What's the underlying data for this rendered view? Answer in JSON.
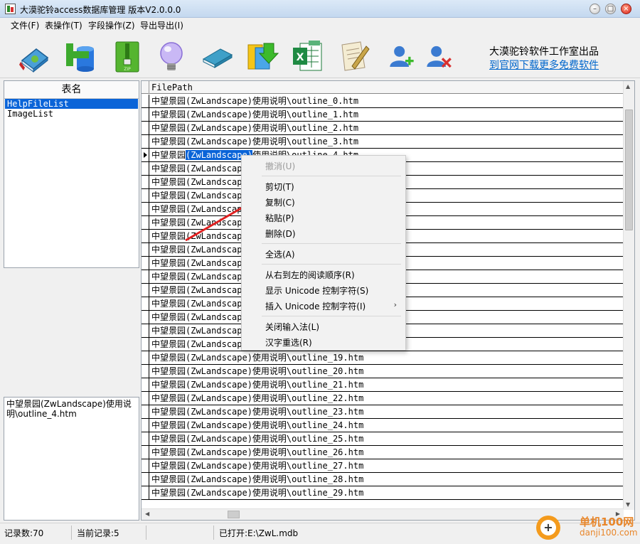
{
  "window": {
    "title": "大漠驼铃access数据库管理 版本V2.0.0.0",
    "minimize_label": "–",
    "maximize_label": "□",
    "close_label": "×"
  },
  "menu": [
    "文件(F)",
    "表操作(T)",
    "字段操作(Z)",
    "导出导出(I)"
  ],
  "toolbar": {
    "icons": [
      "open-database-icon",
      "add-table-icon",
      "zip-icon",
      "lightbulb-icon",
      "book-icon",
      "import-icon",
      "excel-export-icon",
      "edit-document-icon",
      "add-user-icon",
      "remove-user-icon"
    ],
    "studio_name": "大漠驼铃软件工作室出品",
    "download_link": "到官网下载更多免费软件"
  },
  "table_list": {
    "header": "表名",
    "items": [
      "HelpFileList",
      "ImageList"
    ],
    "selected_index": 0
  },
  "detail_text": "中望景园(ZwLandscape)使用说明\\outline_4.htm",
  "grid": {
    "column": "FilePath",
    "current_row": 4,
    "selected_fragment": "(ZwLandscape)",
    "rows": [
      "中望景园(ZwLandscape)使用说明\\outline_0.htm",
      "中望景园(ZwLandscape)使用说明\\outline_1.htm",
      "中望景园(ZwLandscape)使用说明\\outline_2.htm",
      "中望景园(ZwLandscape)使用说明\\outline_3.htm",
      "中望景园(ZwLandscape)使用说明\\outline_4.htm",
      "中望景园(ZwLandscape)使用说明\\outline_5.htm",
      "中望景园(ZwLandscape)使用说明\\outline_6.htm",
      "中望景园(ZwLandscape)使用说明\\outline_7.htm",
      "中望景园(ZwLandscape)使用说明\\outline_8.htm",
      "中望景园(ZwLandscape)使用说明\\outline_9.htm",
      "中望景园(ZwLandscape)使用说明\\outline_10.htm",
      "中望景园(ZwLandscape)使用说明\\outline_11.htm",
      "中望景园(ZwLandscape)使用说明\\outline_12.htm",
      "中望景园(ZwLandscape)使用说明\\outline_13.htm",
      "中望景园(ZwLandscape)使用说明\\outline_14.htm",
      "中望景园(ZwLandscape)使用说明\\outline_15.htm",
      "中望景园(ZwLandscape)使用说明\\outline_16.htm",
      "中望景园(ZwLandscape)使用说明\\outline_17.htm",
      "中望景园(ZwLandscape)使用说明\\outline_18.htm",
      "中望景园(ZwLandscape)使用说明\\outline_19.htm",
      "中望景园(ZwLandscape)使用说明\\outline_20.htm",
      "中望景园(ZwLandscape)使用说明\\outline_21.htm",
      "中望景园(ZwLandscape)使用说明\\outline_22.htm",
      "中望景园(ZwLandscape)使用说明\\outline_23.htm",
      "中望景园(ZwLandscape)使用说明\\outline_24.htm",
      "中望景园(ZwLandscape)使用说明\\outline_25.htm",
      "中望景园(ZwLandscape)使用说明\\outline_26.htm",
      "中望景园(ZwLandscape)使用说明\\outline_27.htm",
      "中望景园(ZwLandscape)使用说明\\outline_28.htm",
      "中望景园(ZwLandscape)使用说明\\outline_29.htm"
    ]
  },
  "context_menu": {
    "undo": "撤消(U)",
    "cut": "剪切(T)",
    "copy": "复制(C)",
    "paste": "粘贴(P)",
    "delete": "删除(D)",
    "select_all": "全选(A)",
    "rtl": "从右到左的阅读顺序(R)",
    "show_unicode": "显示 Unicode 控制字符(S)",
    "insert_unicode": "插入 Unicode 控制字符(I)",
    "submenu_arrow": "›",
    "close_ime": "关闭输入法(L)",
    "reconvert": "汉字重选(R)"
  },
  "status": {
    "records": "记录数:70",
    "current": "当前记录:5",
    "opened": "已打开:E:\\ZwL.mdb"
  },
  "watermark": {
    "line1": "单机100网",
    "line2": "danji100.com",
    "logo_glyph": "+"
  },
  "colors": {
    "selection": "#0a64d8",
    "link": "#0066cc",
    "annotation_arrow": "#e02020"
  }
}
